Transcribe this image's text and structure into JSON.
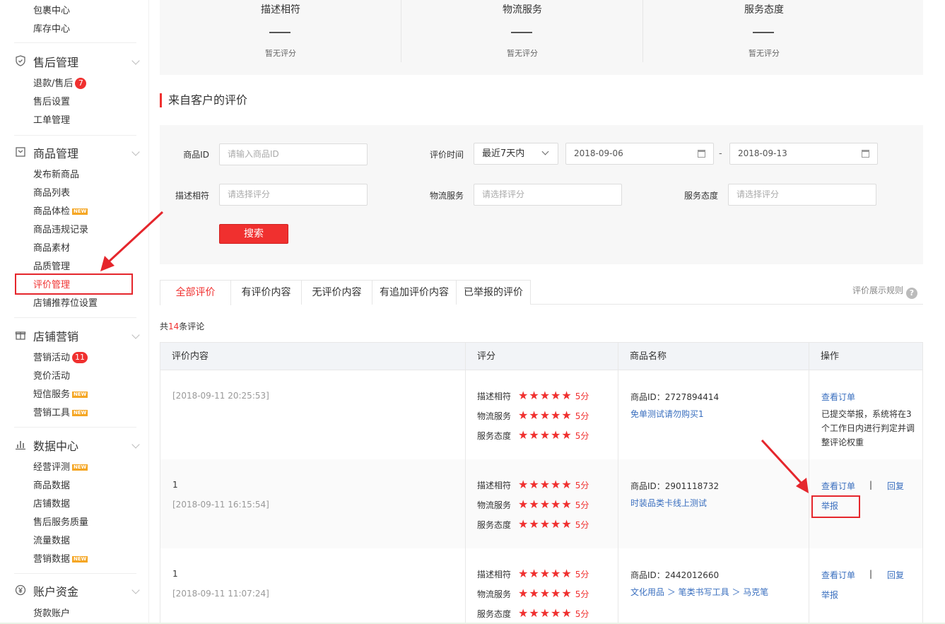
{
  "sidebar": {
    "top_items": [
      "包裹中心",
      "库存中心"
    ],
    "groups": [
      {
        "title": "售后管理",
        "icon": "shield-icon",
        "items": [
          {
            "label": "退款/售后",
            "badge": "7"
          },
          {
            "label": "售后设置"
          },
          {
            "label": "工单管理"
          }
        ]
      },
      {
        "title": "商品管理",
        "icon": "box-icon",
        "items": [
          {
            "label": "发布新商品"
          },
          {
            "label": "商品列表"
          },
          {
            "label": "商品体检",
            "new": "NEW"
          },
          {
            "label": "商品违规记录"
          },
          {
            "label": "商品素材"
          },
          {
            "label": "品质管理"
          },
          {
            "label": "评价管理",
            "active": true
          },
          {
            "label": "店铺推荐位设置"
          }
        ]
      },
      {
        "title": "店铺营销",
        "icon": "gift-icon",
        "items": [
          {
            "label": "营销活动",
            "badge": "11"
          },
          {
            "label": "竞价活动"
          },
          {
            "label": "短信服务",
            "new": "NEW"
          },
          {
            "label": "营销工具",
            "new": "NEW"
          }
        ]
      },
      {
        "title": "数据中心",
        "icon": "chart-icon",
        "items": [
          {
            "label": "经营评测",
            "new": "NEW"
          },
          {
            "label": "商品数据"
          },
          {
            "label": "店铺数据"
          },
          {
            "label": "售后服务质量"
          },
          {
            "label": "流量数据"
          },
          {
            "label": "营销数据",
            "new": "NEW"
          }
        ]
      },
      {
        "title": "账户资金",
        "icon": "yen-icon",
        "items": [
          {
            "label": "货款账户"
          }
        ]
      }
    ]
  },
  "scores": [
    {
      "name": "描述相符",
      "value": "—",
      "status": "暂无评分"
    },
    {
      "name": "物流服务",
      "value": "—",
      "status": "暂无评分"
    },
    {
      "name": "服务态度",
      "value": "—",
      "status": "暂无评分"
    }
  ],
  "section_title": "来自客户的评价",
  "filter": {
    "product_id_label": "商品ID",
    "product_id_placeholder": "请输入商品ID",
    "time_label": "评价时间",
    "time_select": "最近7天内",
    "date_start": "2018-09-06",
    "date_sep": "-",
    "date_end": "2018-09-13",
    "desc_label": "描述相符",
    "desc_placeholder": "请选择评分",
    "logistics_label": "物流服务",
    "logistics_placeholder": "请选择评分",
    "service_label": "服务态度",
    "service_placeholder": "请选择评分",
    "search_button": "搜索"
  },
  "tabs": [
    "全部评价",
    "有评价内容",
    "无评价内容",
    "有追加评价内容",
    "已举报的评价"
  ],
  "rule_link": "评价展示规则",
  "help_icon": "?",
  "count": {
    "prefix": "共",
    "number": "14",
    "suffix": "条评论"
  },
  "table": {
    "headers": [
      "评价内容",
      "评分",
      "商品名称",
      "操作"
    ],
    "score_labels": [
      "描述相符",
      "物流服务",
      "服务态度"
    ],
    "rows": [
      {
        "content": "",
        "time": "[2018-09-11 20:25:53]",
        "scores": [
          "5分",
          "5分",
          "5分"
        ],
        "stars": 5,
        "product_id": "商品ID：2727894414",
        "product_name": "免单测试请勿购买1",
        "view_order": "查看订单",
        "note": "已提交举报，系统将在3个工作日内进行判定并调整评论权重"
      },
      {
        "content": "1",
        "time": "[2018-09-11 16:15:54]",
        "scores": [
          "5分",
          "5分",
          "5分"
        ],
        "stars": 5,
        "product_id": "商品ID：2901118732",
        "product_name": "时装品类卡线上测试",
        "view_order": "查看订单",
        "sep": "|",
        "reply": "回复",
        "report": "举报"
      },
      {
        "content": "1",
        "time": "[2018-09-11 11:07:24]",
        "scores": [
          "5分",
          "5分",
          "5分"
        ],
        "stars": 5,
        "product_id": "商品ID：2442012660",
        "product_name": "文化用品 ＞ 笔类书写工具 ＞ 马克笔",
        "view_order": "查看订单",
        "sep": "|",
        "reply": "回复",
        "report": "举报"
      }
    ]
  },
  "colors": {
    "accent": "#f0302f",
    "link": "#3a6fbf",
    "annotation": "#e5262c"
  }
}
